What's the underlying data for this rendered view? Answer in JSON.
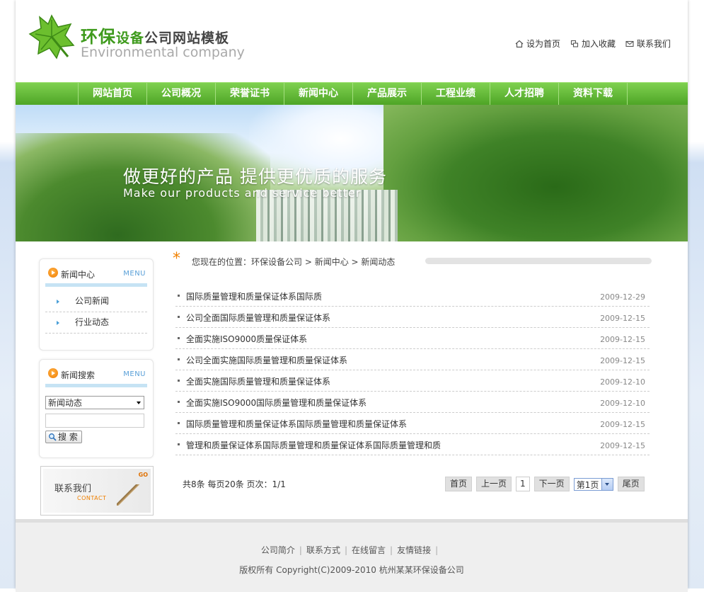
{
  "header": {
    "logo_main": "环保",
    "logo_mid": "设备",
    "logo_tail": "公司网站模板",
    "logo_sub": "Environmental company",
    "links": [
      "设为首页",
      "加入收藏",
      "联系我们"
    ]
  },
  "nav": [
    "网站首页",
    "公司概况",
    "荣誉证书",
    "新闻中心",
    "产品展示",
    "工程业绩",
    "人才招聘",
    "资料下载"
  ],
  "banner": {
    "slogan": "做更好的产品 提供更优质的服务",
    "slogan_en": "Make our products and service better"
  },
  "sidebar": {
    "news_box": {
      "title": "新闻中心",
      "menu": "MENU",
      "items": [
        "公司新闻",
        "行业动态"
      ]
    },
    "search_box": {
      "title": "新闻搜索",
      "menu": "MENU",
      "select_value": "新闻动态",
      "button": "搜 索"
    },
    "contact": {
      "cn": "联系我们",
      "en": "CONTACT",
      "go": "GO"
    }
  },
  "breadcrumb": {
    "prefix": "您现在的位置：",
    "items": [
      "环保设备公司",
      " > 新闻中心",
      " > 新闻动态"
    ]
  },
  "news": [
    {
      "title": "国际质量管理和质量保证体系国际质",
      "date": "2009-12-29"
    },
    {
      "title": "公司全面国际质量管理和质量保证体系",
      "date": "2009-12-15"
    },
    {
      "title": "全面实施ISO9000质量保证体系",
      "date": "2009-12-15"
    },
    {
      "title": "公司全面实施国际质量管理和质量保证体系",
      "date": "2009-12-15"
    },
    {
      "title": "全面实施国际质量管理和质量保证体系",
      "date": "2009-12-10"
    },
    {
      "title": "全面实施ISO9000国际质量管理和质量保证体系",
      "date": "2009-12-10"
    },
    {
      "title": "国际质量管理和质量保证体系国际质量管理和质量保证体系",
      "date": "2009-12-15"
    },
    {
      "title": "管理和质量保证体系国际质量管理和质量保证体系国际质量管理和质",
      "date": "2009-12-15"
    }
  ],
  "pagination": {
    "info": "共8条  每页20条  页次：1/1",
    "first": "首页",
    "prev": "上一页",
    "current": "1",
    "next": "下一页",
    "select": "第1页",
    "last": "尾页"
  },
  "footer": {
    "links": [
      "公司简介",
      "联系方式",
      "在线留言",
      "友情链接"
    ],
    "copyright": "版权所有  Copyright(C)2009-2010 杭州某某环保设备公司"
  },
  "colors": {
    "nav_green": "#5fb836",
    "logo_green": "#3e9a1c",
    "accent_orange": "#f08000",
    "menu_blue": "#5aa0d8"
  }
}
